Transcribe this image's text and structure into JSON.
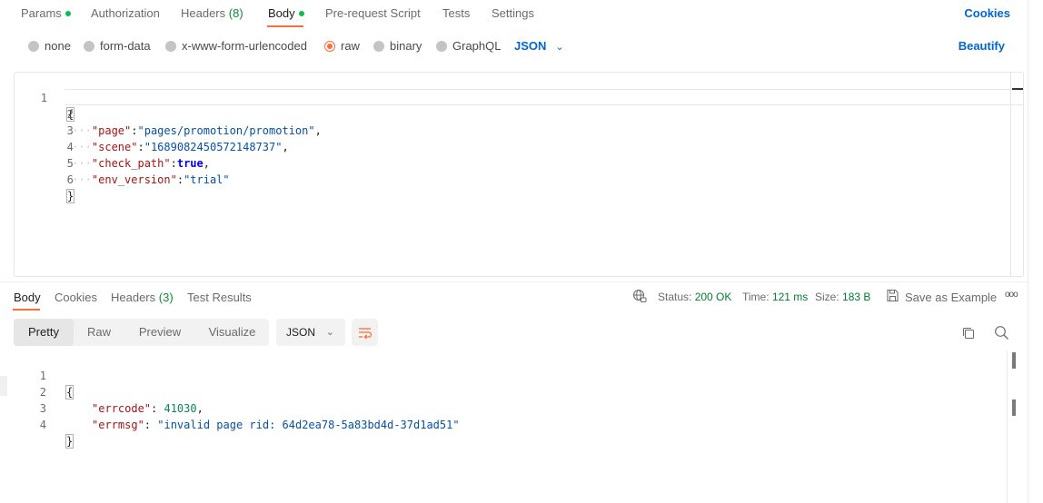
{
  "request_tabs": {
    "params": "Params",
    "authorization": "Authorization",
    "headers": "Headers",
    "headers_count": "(8)",
    "body": "Body",
    "prerequest": "Pre-request Script",
    "tests": "Tests",
    "settings": "Settings",
    "cookies": "Cookies"
  },
  "body_types": {
    "none": "none",
    "form_data": "form-data",
    "urlencoded": "x-www-form-urlencoded",
    "raw": "raw",
    "binary": "binary",
    "graphql": "GraphQL",
    "format": "JSON",
    "beautify": "Beautify",
    "selected": "raw"
  },
  "request_body": {
    "line_numbers": [
      "1",
      "2",
      "3",
      "4",
      "5",
      "6"
    ],
    "open_brace": "{",
    "close_brace": "}",
    "fields": [
      {
        "key": "\"page\"",
        "sep": ":",
        "value": "\"pages/promotion/promotion\"",
        "trail": ","
      },
      {
        "key": "\"scene\"",
        "sep": ":",
        "value": "\"1689082450572148737\"",
        "trail": ","
      },
      {
        "key": "\"check_path\"",
        "sep": ":",
        "value": "true",
        "trail": ","
      },
      {
        "key": "\"env_version\"",
        "sep": ":",
        "value": "\"trial\"",
        "trail": ""
      }
    ],
    "indent_marker": "····"
  },
  "response_tabs": {
    "body": "Body",
    "cookies": "Cookies",
    "headers": "Headers",
    "headers_count": "(3)",
    "test_results": "Test Results"
  },
  "response_status": {
    "status_label": "Status:",
    "status_value": "200 OK",
    "time_label": "Time:",
    "time_value": "121 ms",
    "size_label": "Size:",
    "size_value": "183 B",
    "save_example": "Save as Example",
    "more": "ooo"
  },
  "response_view": {
    "modes": [
      "Pretty",
      "Raw",
      "Preview",
      "Visualize"
    ],
    "active_mode": "Pretty",
    "format": "JSON"
  },
  "response_body": {
    "line_numbers": [
      "1",
      "2",
      "3",
      "4"
    ],
    "open_brace": "{",
    "close_brace": "}",
    "fields": [
      {
        "key": "\"errcode\"",
        "sep": ": ",
        "value": "41030",
        "trail": ","
      },
      {
        "key": "\"errmsg\"",
        "sep": ": ",
        "value": "\"invalid page rid: 64d2ea78-5a83bd4d-37d1ad51\"",
        "trail": ""
      }
    ]
  },
  "colors": {
    "accent": "#ff6c37",
    "link": "#0265d2",
    "status_green": "#007f31",
    "dot_green": "#0cbb52"
  },
  "icons": [
    "globe-lock-icon",
    "save-icon",
    "more-options-icon",
    "wrap-lines-icon",
    "copy-icon",
    "search-icon",
    "chevron-down-icon"
  ]
}
